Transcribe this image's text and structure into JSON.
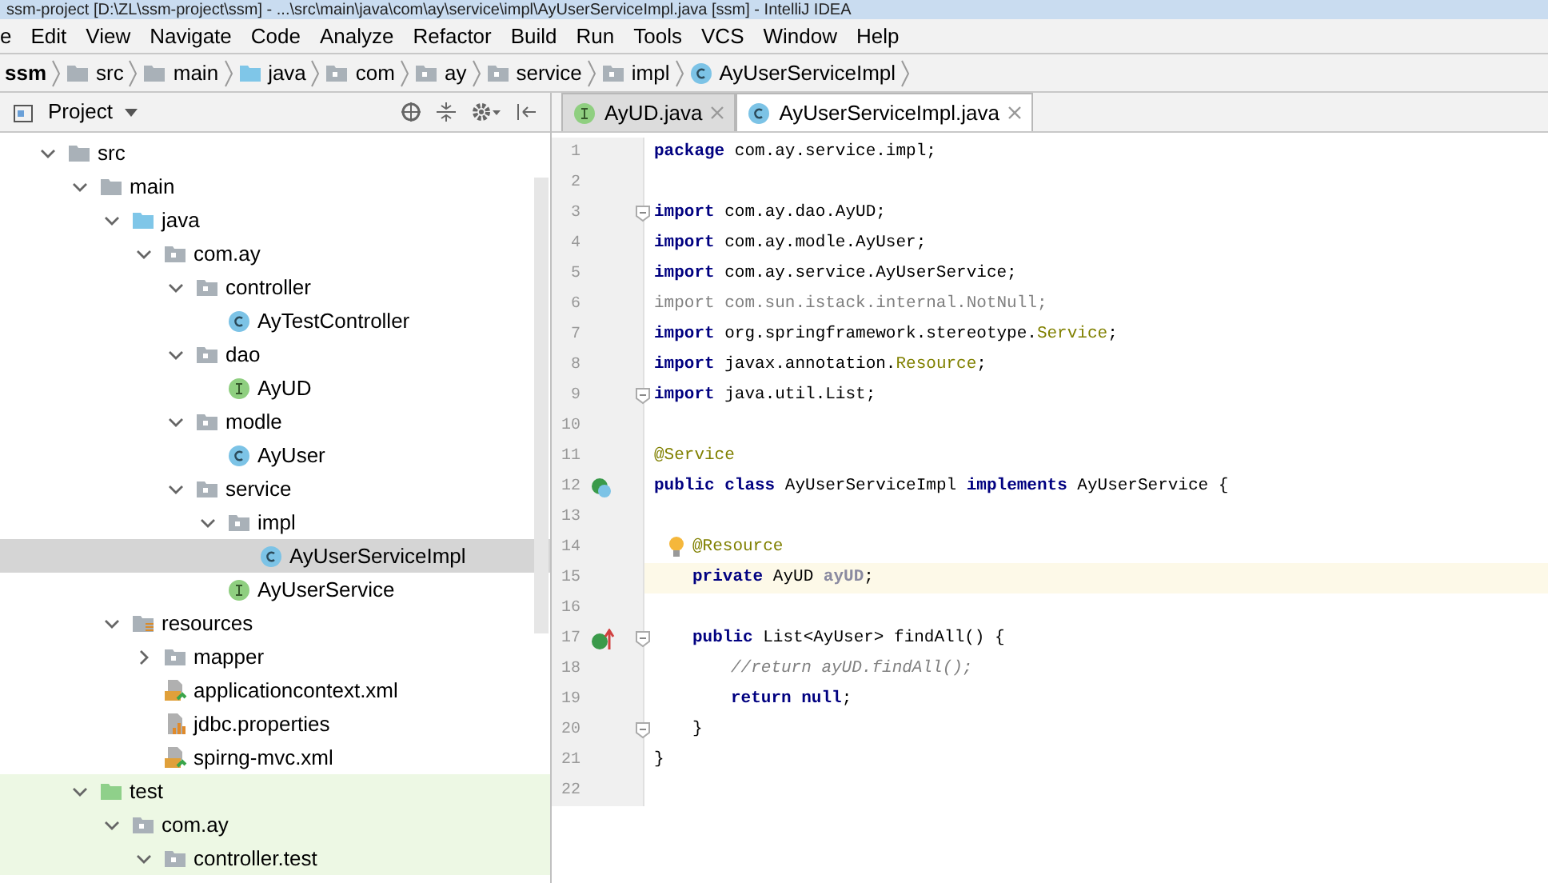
{
  "window": {
    "title": "ssm-project [D:\\ZL\\ssm-project\\ssm] - ...\\src\\main\\java\\com\\ay\\service\\impl\\AyUserServiceImpl.java [ssm] - IntelliJ IDEA"
  },
  "menu": [
    "e",
    "Edit",
    "View",
    "Navigate",
    "Code",
    "Analyze",
    "Refactor",
    "Build",
    "Run",
    "Tools",
    "VCS",
    "Window",
    "Help"
  ],
  "breadcrumbs": [
    {
      "label": "ssm",
      "kind": "module"
    },
    {
      "label": "src",
      "kind": "folder"
    },
    {
      "label": "main",
      "kind": "folder"
    },
    {
      "label": "java",
      "kind": "source"
    },
    {
      "label": "com",
      "kind": "package"
    },
    {
      "label": "ay",
      "kind": "package"
    },
    {
      "label": "service",
      "kind": "package"
    },
    {
      "label": "impl",
      "kind": "package"
    },
    {
      "label": "AyUserServiceImpl",
      "kind": "class"
    }
  ],
  "project_panel": {
    "title": "Project",
    "tree": [
      {
        "label": "src",
        "kind": "folder",
        "expanded": true,
        "selected": false,
        "children": [
          {
            "label": "main",
            "kind": "folder",
            "expanded": true,
            "selected": false,
            "children": [
              {
                "label": "java",
                "kind": "source",
                "expanded": true,
                "selected": false,
                "children": [
                  {
                    "label": "com.ay",
                    "kind": "package",
                    "expanded": true,
                    "selected": false,
                    "children": [
                      {
                        "label": "controller",
                        "kind": "package",
                        "expanded": true,
                        "selected": false,
                        "children": [
                          {
                            "label": "AyTestController",
                            "kind": "class",
                            "selected": false
                          }
                        ]
                      },
                      {
                        "label": "dao",
                        "kind": "package",
                        "expanded": true,
                        "selected": false,
                        "children": [
                          {
                            "label": "AyUD",
                            "kind": "interface",
                            "selected": false
                          }
                        ]
                      },
                      {
                        "label": "modle",
                        "kind": "package",
                        "expanded": true,
                        "selected": false,
                        "children": [
                          {
                            "label": "AyUser",
                            "kind": "class",
                            "selected": false
                          }
                        ]
                      },
                      {
                        "label": "service",
                        "kind": "package",
                        "expanded": true,
                        "selected": false,
                        "children": [
                          {
                            "label": "impl",
                            "kind": "package",
                            "expanded": true,
                            "selected": false,
                            "children": [
                              {
                                "label": "AyUserServiceImpl",
                                "kind": "class",
                                "selected": true
                              }
                            ]
                          },
                          {
                            "label": "AyUserService",
                            "kind": "interface",
                            "selected": false
                          }
                        ]
                      }
                    ]
                  }
                ]
              },
              {
                "label": "resources",
                "kind": "resources",
                "expanded": true,
                "selected": false,
                "children": [
                  {
                    "label": "mapper",
                    "kind": "package",
                    "expanded": false,
                    "selected": false
                  },
                  {
                    "label": "applicationcontext.xml",
                    "kind": "xml",
                    "selected": false
                  },
                  {
                    "label": "jdbc.properties",
                    "kind": "properties",
                    "selected": false
                  },
                  {
                    "label": "spirng-mvc.xml",
                    "kind": "xml",
                    "selected": false
                  }
                ]
              }
            ]
          },
          {
            "label": "test",
            "kind": "test",
            "expanded": true,
            "selected": false,
            "children": [
              {
                "label": "com.ay",
                "kind": "package",
                "expanded": true,
                "selected": false,
                "children": [
                  {
                    "label": "controller.test",
                    "kind": "package",
                    "expanded": true,
                    "selected": false
                  }
                ]
              }
            ]
          }
        ]
      }
    ]
  },
  "tabs": [
    {
      "label": "AyUD.java",
      "kind": "interface",
      "selected": false
    },
    {
      "label": "AyUserServiceImpl.java",
      "kind": "class",
      "selected": true
    }
  ],
  "editor": {
    "lines": [
      {
        "number": "1",
        "kind": "plain",
        "fold": false,
        "current": false,
        "tokens": [
          {
            "kind": "kw",
            "text": "package"
          },
          {
            "kind": "text",
            "text": " com.ay.service.impl;"
          }
        ]
      },
      {
        "number": "2",
        "kind": "plain",
        "fold": false,
        "current": false
      },
      {
        "number": "3",
        "kind": "plain",
        "fold": true,
        "current": false,
        "tokens": [
          {
            "kind": "kw",
            "text": "import"
          },
          {
            "kind": "text",
            "text": " com.ay.dao.AyUD;"
          }
        ]
      },
      {
        "number": "4",
        "kind": "plain",
        "fold": false,
        "current": false,
        "tokens": [
          {
            "kind": "kw",
            "text": "import"
          },
          {
            "kind": "text",
            "text": " com.ay.modle.AyUser;"
          }
        ]
      },
      {
        "number": "5",
        "kind": "plain",
        "fold": false,
        "current": false,
        "tokens": [
          {
            "kind": "kw",
            "text": "import"
          },
          {
            "kind": "text",
            "text": " com.ay.service.AyUserService;"
          }
        ]
      },
      {
        "number": "6",
        "kind": "plain",
        "fold": false,
        "current": false,
        "tokens": [
          {
            "kind": "unused",
            "text": "import com.sun.istack.internal.NotNull;"
          }
        ]
      },
      {
        "number": "7",
        "kind": "plain",
        "fold": false,
        "current": false,
        "tokens": [
          {
            "kind": "kw",
            "text": "import"
          },
          {
            "kind": "text",
            "text": " org.springframework.stereotype."
          },
          {
            "kind": "ann",
            "text": "Service"
          },
          {
            "kind": "text",
            "text": ";"
          }
        ]
      },
      {
        "number": "8",
        "kind": "plain",
        "fold": false,
        "current": false,
        "tokens": [
          {
            "kind": "kw",
            "text": "import"
          },
          {
            "kind": "text",
            "text": " javax.annotation."
          },
          {
            "kind": "ann",
            "text": "Resource"
          },
          {
            "kind": "text",
            "text": ";"
          }
        ]
      },
      {
        "number": "9",
        "kind": "plain",
        "fold": true,
        "current": false,
        "tokens": [
          {
            "kind": "kw",
            "text": "import"
          },
          {
            "kind": "text",
            "text": " java.util.List;"
          }
        ]
      },
      {
        "number": "10",
        "kind": "plain",
        "fold": false,
        "current": false
      },
      {
        "number": "11",
        "kind": "plain",
        "fold": false,
        "current": false,
        "tokens": [
          {
            "kind": "ann",
            "text": "@Service"
          }
        ]
      },
      {
        "number": "12",
        "kind": "implemented",
        "fold": false,
        "current": false,
        "tokens": [
          {
            "kind": "kw",
            "text": "public class"
          },
          {
            "kind": "text",
            "text": " AyUserServiceImpl "
          },
          {
            "kind": "kw",
            "text": "implements"
          },
          {
            "kind": "text",
            "text": " AyUserService {"
          }
        ],
        "children": [
          {
            "number": "13",
            "kind": "plain",
            "fold": false,
            "current": false
          },
          {
            "number": "14",
            "kind": "bulb",
            "fold": false,
            "current": false,
            "tokens": [
              {
                "kind": "ann",
                "text": "@Resource"
              }
            ]
          },
          {
            "number": "15",
            "kind": "plain",
            "fold": false,
            "current": true,
            "tokens": [
              {
                "kind": "kw",
                "text": "private"
              },
              {
                "kind": "text",
                "text": " AyUD "
              },
              {
                "kind": "unusedfield",
                "text": "ayUD"
              },
              {
                "kind": "text",
                "text": ";"
              }
            ]
          },
          {
            "number": "16",
            "kind": "plain",
            "fold": false,
            "current": false
          },
          {
            "number": "17",
            "kind": "implementing",
            "fold": true,
            "current": false,
            "tokens": [
              {
                "kind": "kw",
                "text": "public"
              },
              {
                "kind": "text",
                "text": " List<AyUser> findAll() {"
              }
            ],
            "children": [
              {
                "number": "18",
                "kind": "plain",
                "fold": false,
                "current": false,
                "tokens": [
                  {
                    "kind": "comment",
                    "text": "//return ayUD.findAll();"
                  }
                ]
              },
              {
                "number": "19",
                "kind": "plain",
                "fold": false,
                "current": false,
                "tokens": [
                  {
                    "kind": "kw",
                    "text": "return null"
                  },
                  {
                    "kind": "text",
                    "text": ";"
                  }
                ]
              }
            ]
          },
          {
            "number": "20",
            "kind": "plain",
            "fold": true,
            "current": false,
            "tokens": [
              {
                "kind": "text",
                "text": "}"
              }
            ]
          }
        ]
      },
      {
        "number": "21",
        "kind": "plain",
        "fold": false,
        "current": false,
        "tokens": [
          {
            "kind": "text",
            "text": "}"
          }
        ]
      },
      {
        "number": "22",
        "kind": "plain",
        "fold": false,
        "current": false
      }
    ]
  }
}
